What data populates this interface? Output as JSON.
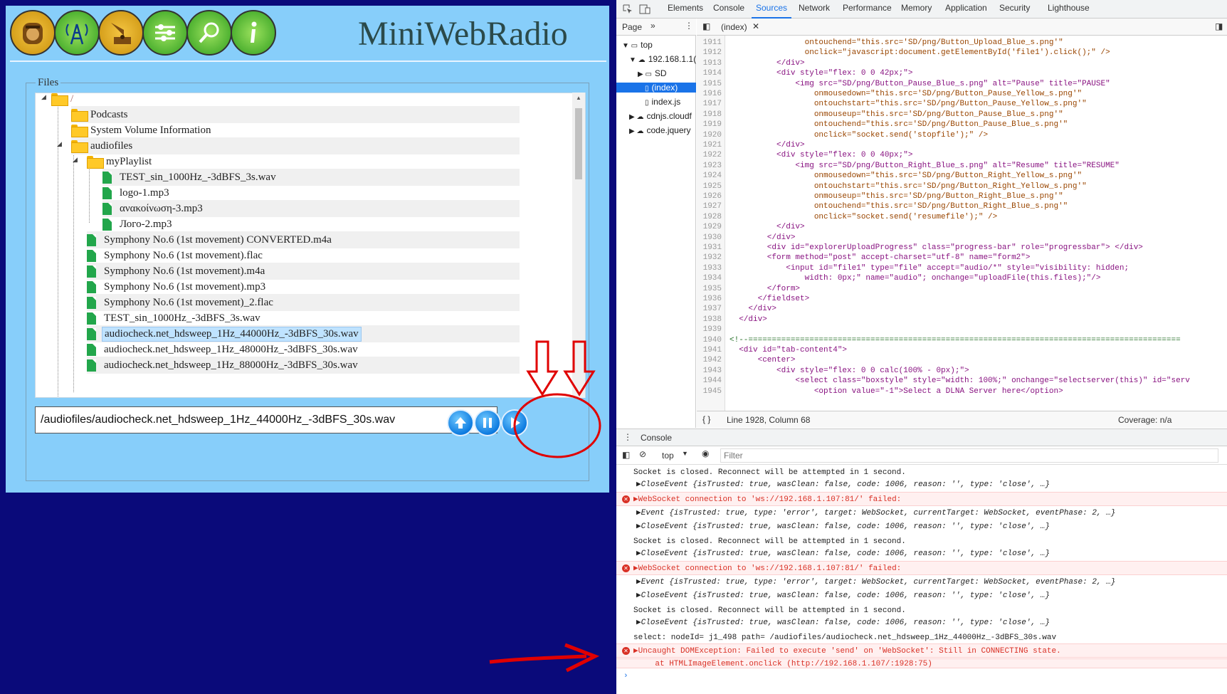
{
  "app": {
    "title": "MiniWebRadio",
    "nav_icons": [
      "radio-icon",
      "antenna-icon",
      "gramophone-icon",
      "equalizer-icon",
      "search-icon",
      "info-icon"
    ],
    "files_legend": "Files",
    "tree": {
      "root": "/",
      "items": [
        {
          "label": "Podcasts",
          "kind": "folder"
        },
        {
          "label": "System Volume Information",
          "kind": "folder"
        },
        {
          "label": "audiofiles",
          "kind": "folder"
        },
        {
          "label": "myPlaylist",
          "kind": "folder"
        },
        {
          "label": "TEST_sin_1000Hz_-3dBFS_3s.wav",
          "kind": "file"
        },
        {
          "label": "logo-1.mp3",
          "kind": "file"
        },
        {
          "label": "ανακοίνωση-3.mp3",
          "kind": "file"
        },
        {
          "label": "Лого-2.mp3",
          "kind": "file"
        },
        {
          "label": "Symphony No.6 (1st movement) CONVERTED.m4a",
          "kind": "file"
        },
        {
          "label": "Symphony No.6 (1st movement).flac",
          "kind": "file"
        },
        {
          "label": "Symphony No.6 (1st movement).m4a",
          "kind": "file"
        },
        {
          "label": "Symphony No.6 (1st movement).mp3",
          "kind": "file"
        },
        {
          "label": "Symphony No.6 (1st movement)_2.flac",
          "kind": "file"
        },
        {
          "label": "TEST_sin_1000Hz_-3dBFS_3s.wav",
          "kind": "file"
        },
        {
          "label": "audiocheck.net_hdsweep_1Hz_44000Hz_-3dBFS_30s.wav",
          "kind": "file"
        },
        {
          "label": "audiocheck.net_hdsweep_1Hz_48000Hz_-3dBFS_30s.wav",
          "kind": "file"
        },
        {
          "label": "audiocheck.net_hdsweep_1Hz_88000Hz_-3dBFS_30s.wav",
          "kind": "file"
        }
      ]
    },
    "path_value": "/audiofiles/audiocheck.net_hdsweep_1Hz_44000Hz_-3dBFS_30s.wav",
    "buttons": [
      "upload-button",
      "pause-button",
      "resume-button"
    ],
    "colors": {
      "panel": "#87cefa",
      "background": "#0a0a7a",
      "annotation": "#e00000"
    }
  },
  "devtools": {
    "tabs": [
      "Elements",
      "Console",
      "Sources",
      "Network",
      "Performance",
      "Memory",
      "Application",
      "Security",
      "Lighthouse"
    ],
    "active_tab": "Sources",
    "navigator": {
      "header": "Page",
      "items": [
        "top",
        "192.168.1.1(",
        "SD",
        "(index)",
        "index.js",
        "cdnjs.cloudf",
        "code.jquery"
      ]
    },
    "editor_tab": "(index)",
    "status_line": "Line 1928, Column 68",
    "coverage": "Coverage: n/a",
    "code_start_line": 1911,
    "code": [
      "                ontouchend=\"this.src='SD/png/Button_Upload_Blue_s.png'\"",
      "                onclick=\"javascript:document.getElementById('file1').click();\" />",
      "          </div>",
      "          <div style=\"flex: 0 0 42px;\">",
      "              <img src=\"SD/png/Button_Pause_Blue_s.png\" alt=\"Pause\" title=\"PAUSE\"",
      "                  onmousedown=\"this.src='SD/png/Button_Pause_Yellow_s.png'\"",
      "                  ontouchstart=\"this.src='SD/png/Button_Pause_Yellow_s.png'\"",
      "                  onmouseup=\"this.src='SD/png/Button_Pause_Blue_s.png'\"",
      "                  ontouchend=\"this.src='SD/png/Button_Pause_Blue_s.png'\"",
      "                  onclick=\"socket.send('stopfile');\" />",
      "          </div>",
      "          <div style=\"flex: 0 0 40px;\">",
      "              <img src=\"SD/png/Button_Right_Blue_s.png\" alt=\"Resume\" title=\"RESUME\"",
      "                  onmousedown=\"this.src='SD/png/Button_Right_Yellow_s.png'\"",
      "                  ontouchstart=\"this.src='SD/png/Button_Right_Yellow_s.png'\"",
      "                  onmouseup=\"this.src='SD/png/Button_Right_Blue_s.png'\"",
      "                  ontouchend=\"this.src='SD/png/Button_Right_Blue_s.png'\"",
      "                  onclick=\"socket.send('resumefile');\" />",
      "          </div>",
      "        </div>",
      "        <div id=\"explorerUploadProgress\" class=\"progress-bar\" role=\"progressbar\"> </div>",
      "        <form method=\"post\" accept-charset=\"utf-8\" name=\"form2\">",
      "            <input id=\"file1\" type=\"file\" accept=\"audio/*\" style=\"visibility: hidden;",
      "                width: 0px;\" name=\"audio\"; onchange=\"uploadFile(this.files);\"/>",
      "        </form>",
      "      </fieldset>",
      "    </div>",
      "  </div>",
      "",
      "<!--============================================================================================",
      "  <div id=\"tab-content4\">",
      "      <center>",
      "          <div style=\"flex: 0 0 calc(100% - 0px);\">",
      "              <select class=\"boxstyle\" style=\"width: 100%;\" onchange=\"selectserver(this)\" id=\"serv",
      "                  <option value=\"-1\">Select a DLNA Server here</option>"
    ],
    "console": {
      "tab": "Console",
      "context": "top",
      "filter_placeholder": "Filter",
      "messages": [
        {
          "type": "log",
          "text": "Socket is closed. Reconnect will be attempted in 1 second."
        },
        {
          "type": "obj",
          "text": "▶CloseEvent {isTrusted: true, wasClean: false, code: 1006, reason: '', type: 'close', …}"
        },
        {
          "type": "error",
          "text": "▶WebSocket connection to 'ws://192.168.1.107:81/' failed:"
        },
        {
          "type": "obj",
          "text": "▶Event {isTrusted: true, type: 'error', target: WebSocket, currentTarget: WebSocket, eventPhase: 2, …}"
        },
        {
          "type": "obj",
          "text": "▶CloseEvent {isTrusted: true, wasClean: false, code: 1006, reason: '', type: 'close', …}"
        },
        {
          "type": "log",
          "text": "Socket is closed. Reconnect will be attempted in 1 second."
        },
        {
          "type": "obj",
          "text": "▶CloseEvent {isTrusted: true, wasClean: false, code: 1006, reason: '', type: 'close', …}"
        },
        {
          "type": "error",
          "text": "▶WebSocket connection to 'ws://192.168.1.107:81/' failed:"
        },
        {
          "type": "obj",
          "text": "▶Event {isTrusted: true, type: 'error', target: WebSocket, currentTarget: WebSocket, eventPhase: 2, …}"
        },
        {
          "type": "obj",
          "text": "▶CloseEvent {isTrusted: true, wasClean: false, code: 1006, reason: '', type: 'close', …}"
        },
        {
          "type": "log",
          "text": "Socket is closed. Reconnect will be attempted in 1 second."
        },
        {
          "type": "obj",
          "text": "▶CloseEvent {isTrusted: true, wasClean: false, code: 1006, reason: '', type: 'close', …}"
        },
        {
          "type": "log",
          "text": "select: nodeId= j1_498 path= /audiofiles/audiocheck.net_hdsweep_1Hz_44000Hz_-3dBFS_30s.wav"
        },
        {
          "type": "error",
          "text": "▶Uncaught DOMException: Failed to execute 'send' on 'WebSocket': Still in CONNECTING state."
        },
        {
          "type": "error-sub",
          "text": "    at HTMLImageElement.onclick (http://192.168.1.107/:1928:75)"
        }
      ],
      "prompt": "›"
    }
  }
}
